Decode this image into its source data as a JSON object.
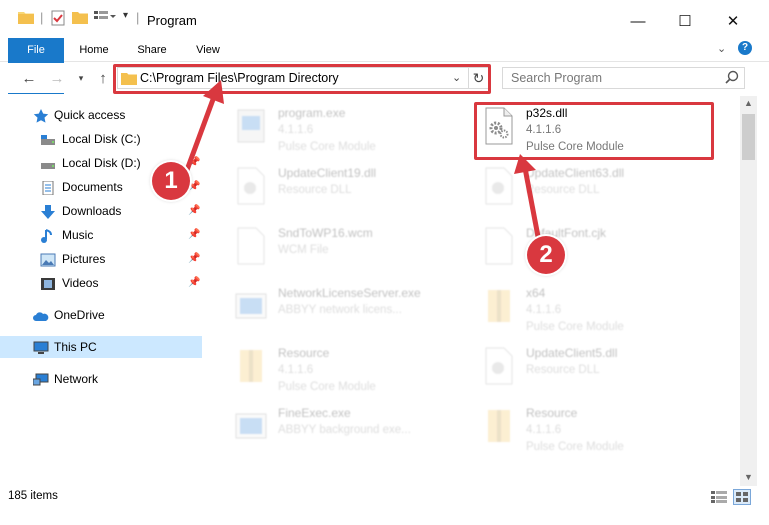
{
  "window": {
    "title": "Program",
    "minimize_glyph": "—",
    "maximize_glyph": "☐",
    "close_glyph": "✕"
  },
  "ribbon": {
    "tabs": [
      "File",
      "Home",
      "Share",
      "View"
    ]
  },
  "navigation": {
    "address": "C:\\Program Files\\Program Directory",
    "search_placeholder": "Search Program"
  },
  "sidebar": {
    "items": [
      {
        "label": "Quick access",
        "icon": "star-icon"
      },
      {
        "label": "Local Disk (C:)",
        "icon": "drive-icon"
      },
      {
        "label": "Local Disk (D:)",
        "icon": "drive-icon"
      },
      {
        "label": "Documents",
        "icon": "documents-icon"
      },
      {
        "label": "Downloads",
        "icon": "download-icon"
      },
      {
        "label": "Music",
        "icon": "music-icon"
      },
      {
        "label": "Pictures",
        "icon": "pictures-icon"
      },
      {
        "label": "Videos",
        "icon": "videos-icon"
      },
      {
        "label": "OneDrive",
        "icon": "cloud-icon"
      },
      {
        "label": "This PC",
        "icon": "computer-icon"
      },
      {
        "label": "Network",
        "icon": "network-icon"
      }
    ]
  },
  "files": [
    {
      "name": "program.exe",
      "version": "4.1.1.6",
      "description": "Pulse Core Module",
      "icon": "exe-icon",
      "highlighted": false
    },
    {
      "name": "p32s.dll",
      "version": "4.1.1.6",
      "description": "Pulse Core Module",
      "icon": "dll-gear-icon",
      "highlighted": true
    },
    {
      "name": "UpdateClient19.dll",
      "version": "",
      "description": "Resource DLL",
      "icon": "dll-gear-icon",
      "highlighted": false
    },
    {
      "name": "UpdateClient63.dll",
      "version": "",
      "description": "Resource DLL",
      "icon": "dll-gear-icon",
      "highlighted": false
    },
    {
      "name": "SndToWP16.wcm",
      "version": "",
      "description": "WCM File",
      "icon": "blank-file-icon",
      "highlighted": false
    },
    {
      "name": "DefaultFont.cjk",
      "version": "",
      "description": "",
      "icon": "blank-file-icon",
      "highlighted": false
    },
    {
      "name": "NetworkLicenseServer.exe",
      "version": "",
      "description": "ABBYY network licens...",
      "icon": "window-exe-icon",
      "highlighted": false
    },
    {
      "name": "x64",
      "version": "4.1.1.6",
      "description": "Pulse Core Module",
      "icon": "folder-zip-icon",
      "highlighted": false
    },
    {
      "name": "Resource",
      "version": "4.1.1.6",
      "description": "Pulse Core Module",
      "icon": "folder-zip-icon",
      "highlighted": false
    },
    {
      "name": "UpdateClient5.dll",
      "version": "",
      "description": "Resource DLL",
      "icon": "dll-gear-icon",
      "highlighted": false
    },
    {
      "name": "FineExec.exe",
      "version": "",
      "description": "ABBYY background exe...",
      "icon": "window-exe-icon",
      "highlighted": false
    },
    {
      "name": "Resource",
      "version": "4.1.1.6",
      "description": "Pulse Core Module",
      "icon": "folder-zip-icon",
      "highlighted": false
    }
  ],
  "status": {
    "item_count": "185 items"
  },
  "annotations": {
    "step1": "1",
    "step2": "2",
    "highlight_color": "#d9383f"
  },
  "colors": {
    "accent": "#1979ca",
    "selected_bg": "#cce8ff"
  }
}
